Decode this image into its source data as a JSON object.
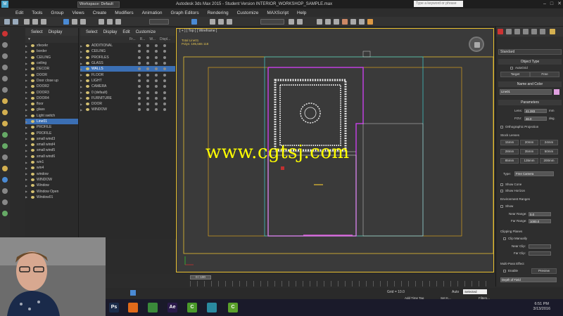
{
  "titlebar": {
    "workspace": "Workspace: Default",
    "app_title": "Autodesk 3ds Max 2015  -  Student Version    INTERIOR_WORKSHOP_SAMPLE.max",
    "search_placeholder": "Type a keyword or phrase"
  },
  "menu": [
    "Edit",
    "Tools",
    "Group",
    "Views",
    "Create",
    "Modifiers",
    "Animation",
    "Graph Editors",
    "Rendering",
    "Customize",
    "MAXScript",
    "Help"
  ],
  "explorer1": {
    "menu": [
      "Select",
      "Display"
    ],
    "rows": [
      "xfecekr",
      "border",
      "CEILING",
      "ceiling",
      "DECOR",
      "DOOR",
      "Door close up",
      "DOOR2",
      "DOOR3",
      "DOOR4",
      "floor",
      "glass",
      "Light switch",
      "Line01",
      "PROFILE",
      "PROFILE",
      "small wind3",
      "small wind4",
      "small wind5",
      "small wind6",
      "win1",
      "win4",
      "window",
      "WINDOW",
      "Window",
      "Window Open",
      "Window01"
    ],
    "selected_index": 13
  },
  "explorer2": {
    "menu": [
      "Select",
      "Display",
      "Edit",
      "Customize"
    ],
    "columns": [
      "Fr...",
      "R...",
      "W...",
      "Displ..."
    ],
    "rows": [
      "ADDITIONAL",
      "CEILING",
      "PROFILES",
      "GLASS",
      "WALLS",
      "FLOOR",
      "LIGHT",
      "CAMERA",
      "0 (default)",
      "FURNITURE",
      "DOOR",
      "WINDOW"
    ],
    "selected_index": 4
  },
  "viewport": {
    "label": "[ + ] [ Top ] [ Wireframe ]",
    "info": [
      "Total    Line01",
      "Polys:   195,565    118"
    ],
    "watermark": "www.cgtsj.com"
  },
  "command_panel": {
    "dropdown": "Standard",
    "object_type": "Object Type",
    "autogrid": "AutoGrid",
    "target_btn": "Target",
    "free_btn": "Free",
    "name_color": "Name and Color",
    "name_value": "Line01",
    "parameters": "Parameters",
    "lens_label": "Lens:",
    "lens_value": "41.283",
    "lens_unit": "mm",
    "fov_label": "FOV:",
    "fov_value": "46.0",
    "fov_unit": "deg.",
    "ortho": "Orthographic Projection",
    "stock_lenses": "Stock Lenses",
    "lenses": [
      "15mm",
      "20mm",
      "24mm",
      "28mm",
      "35mm",
      "50mm",
      "85mm",
      "135mm",
      "200mm"
    ],
    "type_label": "Type:",
    "type_value": "Free Camera",
    "show_cone": "Show Cone",
    "show_horizon": "Show Horizon",
    "env_ranges": "Environment Ranges",
    "show": "Show",
    "near_range_label": "Near Range:",
    "near_range_value": "0.0",
    "far_range_label": "Far Range:",
    "far_range_value": "1000.0",
    "clipping": "Clipping Planes",
    "clip_manually": "Clip Manually",
    "near_clip_label": "Near Clip:",
    "far_clip_label": "Far Clip:",
    "multipass": "Multi-Pass Effect",
    "enable": "Enable",
    "preview": "Preview",
    "dof": "Depth of Field"
  },
  "timeline": {
    "slider": "0 / 100",
    "grid": "Grid = 10.0",
    "auto": "Auto",
    "selected": "Selected",
    "set_key": "Set K...",
    "filters": "Filters...",
    "add_time_tag": "Add Time Tag"
  },
  "taskbar": {
    "apps": [
      {
        "label": "Ps",
        "color": "#1b2c4a"
      },
      {
        "label": "",
        "color": "#e06a1a"
      },
      {
        "label": "",
        "color": "#3a8a3a"
      },
      {
        "label": "Ae",
        "color": "#2a1a4a"
      },
      {
        "label": "C",
        "color": "#4a9a2a"
      },
      {
        "label": "",
        "color": "#2a8aa0"
      },
      {
        "label": "C",
        "color": "#5aa02a"
      }
    ],
    "time": "6:51 PM",
    "date": "3/13/2016"
  }
}
